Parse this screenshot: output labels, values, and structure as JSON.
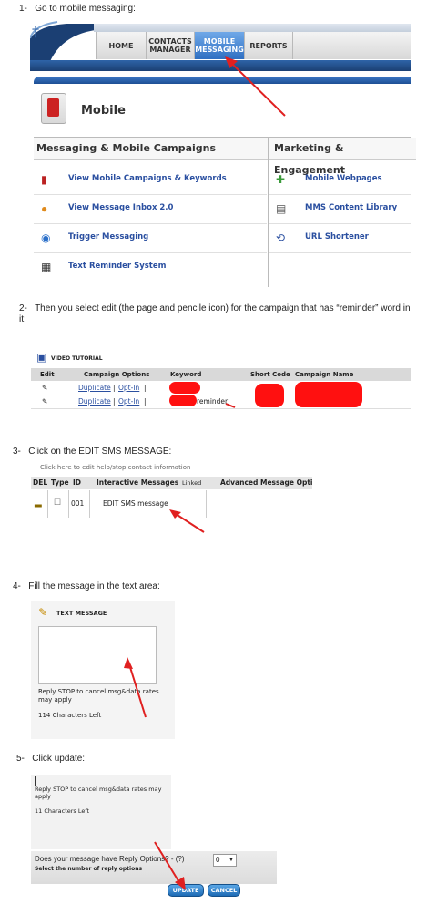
{
  "steps": [
    {
      "num": "1-",
      "text": "Go to mobile messaging:"
    },
    {
      "num": "2-",
      "text": "Then you select edit (the page and pencile icon) for the campaign that has “reminder” word in it:"
    },
    {
      "num": "3-",
      "text": "Click on the EDIT SMS MESSAGE:"
    },
    {
      "num": "4-",
      "text": "Fill the message in the text area:"
    },
    {
      "num": "5-",
      "text": "Click update:"
    }
  ],
  "shot1": {
    "tabs": [
      "HOME",
      "CONTACTS MANAGER",
      "MOBILE MESSAGING",
      "REPORTS"
    ],
    "active_tab": "MOBILE MESSAGING",
    "section_title": "Mobile",
    "col_left": "Messaging & Mobile Campaigns",
    "col_right": "Marketing & Engagement",
    "left_items": [
      {
        "label": "View Mobile Campaigns & Keywords",
        "icon": "phone-icon"
      },
      {
        "label": "View Message Inbox 2.0",
        "icon": "chat-bubble-icon"
      },
      {
        "label": "Trigger Messaging",
        "icon": "trigger-icon"
      },
      {
        "label": "Text Reminder System",
        "icon": "calendar-clock-icon"
      }
    ],
    "right_items": [
      {
        "label": "Mobile Webpages",
        "icon": "add-page-icon"
      },
      {
        "label": "MMS Content Library",
        "icon": "library-icon"
      },
      {
        "label": "URL Shortener",
        "icon": "link-icon"
      }
    ]
  },
  "shot2": {
    "video_tutorial": "VIDEO TUTORIAL",
    "headers": [
      "Edit",
      "Campaign Options",
      "Keyword",
      "Short Code",
      "Campaign Name"
    ],
    "rows": [
      {
        "dup": "Duplicate",
        "sep": "|",
        "optin": "Opt-In",
        "sep2": "|",
        "keyword": ""
      },
      {
        "dup": "Duplicate",
        "sep": "|",
        "optin": "Opt-In",
        "sep2": "|",
        "keyword": "reminder"
      }
    ]
  },
  "shot3": {
    "top_note": "Click here to edit help/stop contact information",
    "headers": [
      "DEL",
      "Type",
      "ID",
      "Interactive Messages",
      "Linked",
      "Advanced Message Opti"
    ],
    "row": {
      "id": "001",
      "message": "EDIT SMS message"
    }
  },
  "shot4": {
    "title": "TEXT MESSAGE",
    "footer": "Reply STOP to cancel msg&data rates may apply",
    "chars_left": "114 Characters Left"
  },
  "shot5": {
    "footer": "Reply STOP to cancel msg&data rates may apply",
    "chars_left": "11 Characters Left",
    "reply_question": "Does your message have Reply Options? - (?)",
    "select_label": "Select the number of reply options",
    "select_value": "0",
    "update_label": "UPDATE",
    "cancel_label": "CANCEL"
  },
  "colors": {
    "accent_blue": "#2f6fc2",
    "link": "#2a4fa0",
    "arrow": "#e02020"
  }
}
